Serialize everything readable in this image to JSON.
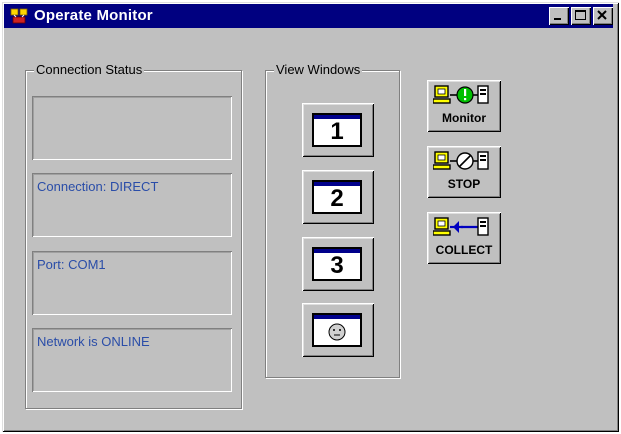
{
  "window": {
    "title": "Operate Monitor"
  },
  "connection_status": {
    "legend": "Connection Status",
    "boxes": [
      "",
      "Connection:  DIRECT",
      "Port:  COM1",
      "Network is ONLINE"
    ]
  },
  "view_windows": {
    "legend": "View Windows",
    "buttons": [
      "1",
      "2",
      "3"
    ]
  },
  "actions": {
    "monitor_label": "Monitor",
    "stop_label": "STOP",
    "collect_label": "COLLECT"
  },
  "colors": {
    "titlebar": "#000080",
    "status_text": "#2a4da8",
    "face": "#c0c0c0"
  }
}
